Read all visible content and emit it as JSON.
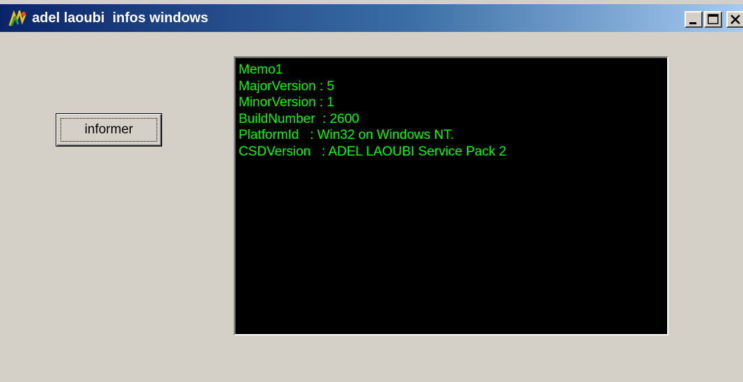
{
  "window": {
    "title": "adel laoubi  infos windows",
    "title_color": "#ffffff",
    "icon": "app-icon",
    "controls": {
      "minimize": "minimize-icon",
      "maximize": "maximize-icon",
      "close": "close-icon"
    }
  },
  "button": {
    "label": "informer"
  },
  "memo": {
    "text_color": "#00ff00",
    "background": "#000000",
    "lines": [
      "Memo1",
      "MajorVersion : 5",
      "MinorVersion : 1",
      "BuildNumber  : 2600",
      "PlatformId   : Win32 on Windows NT.",
      "CSDVersion   : ADEL LAOUBI Service Pack 2"
    ]
  }
}
